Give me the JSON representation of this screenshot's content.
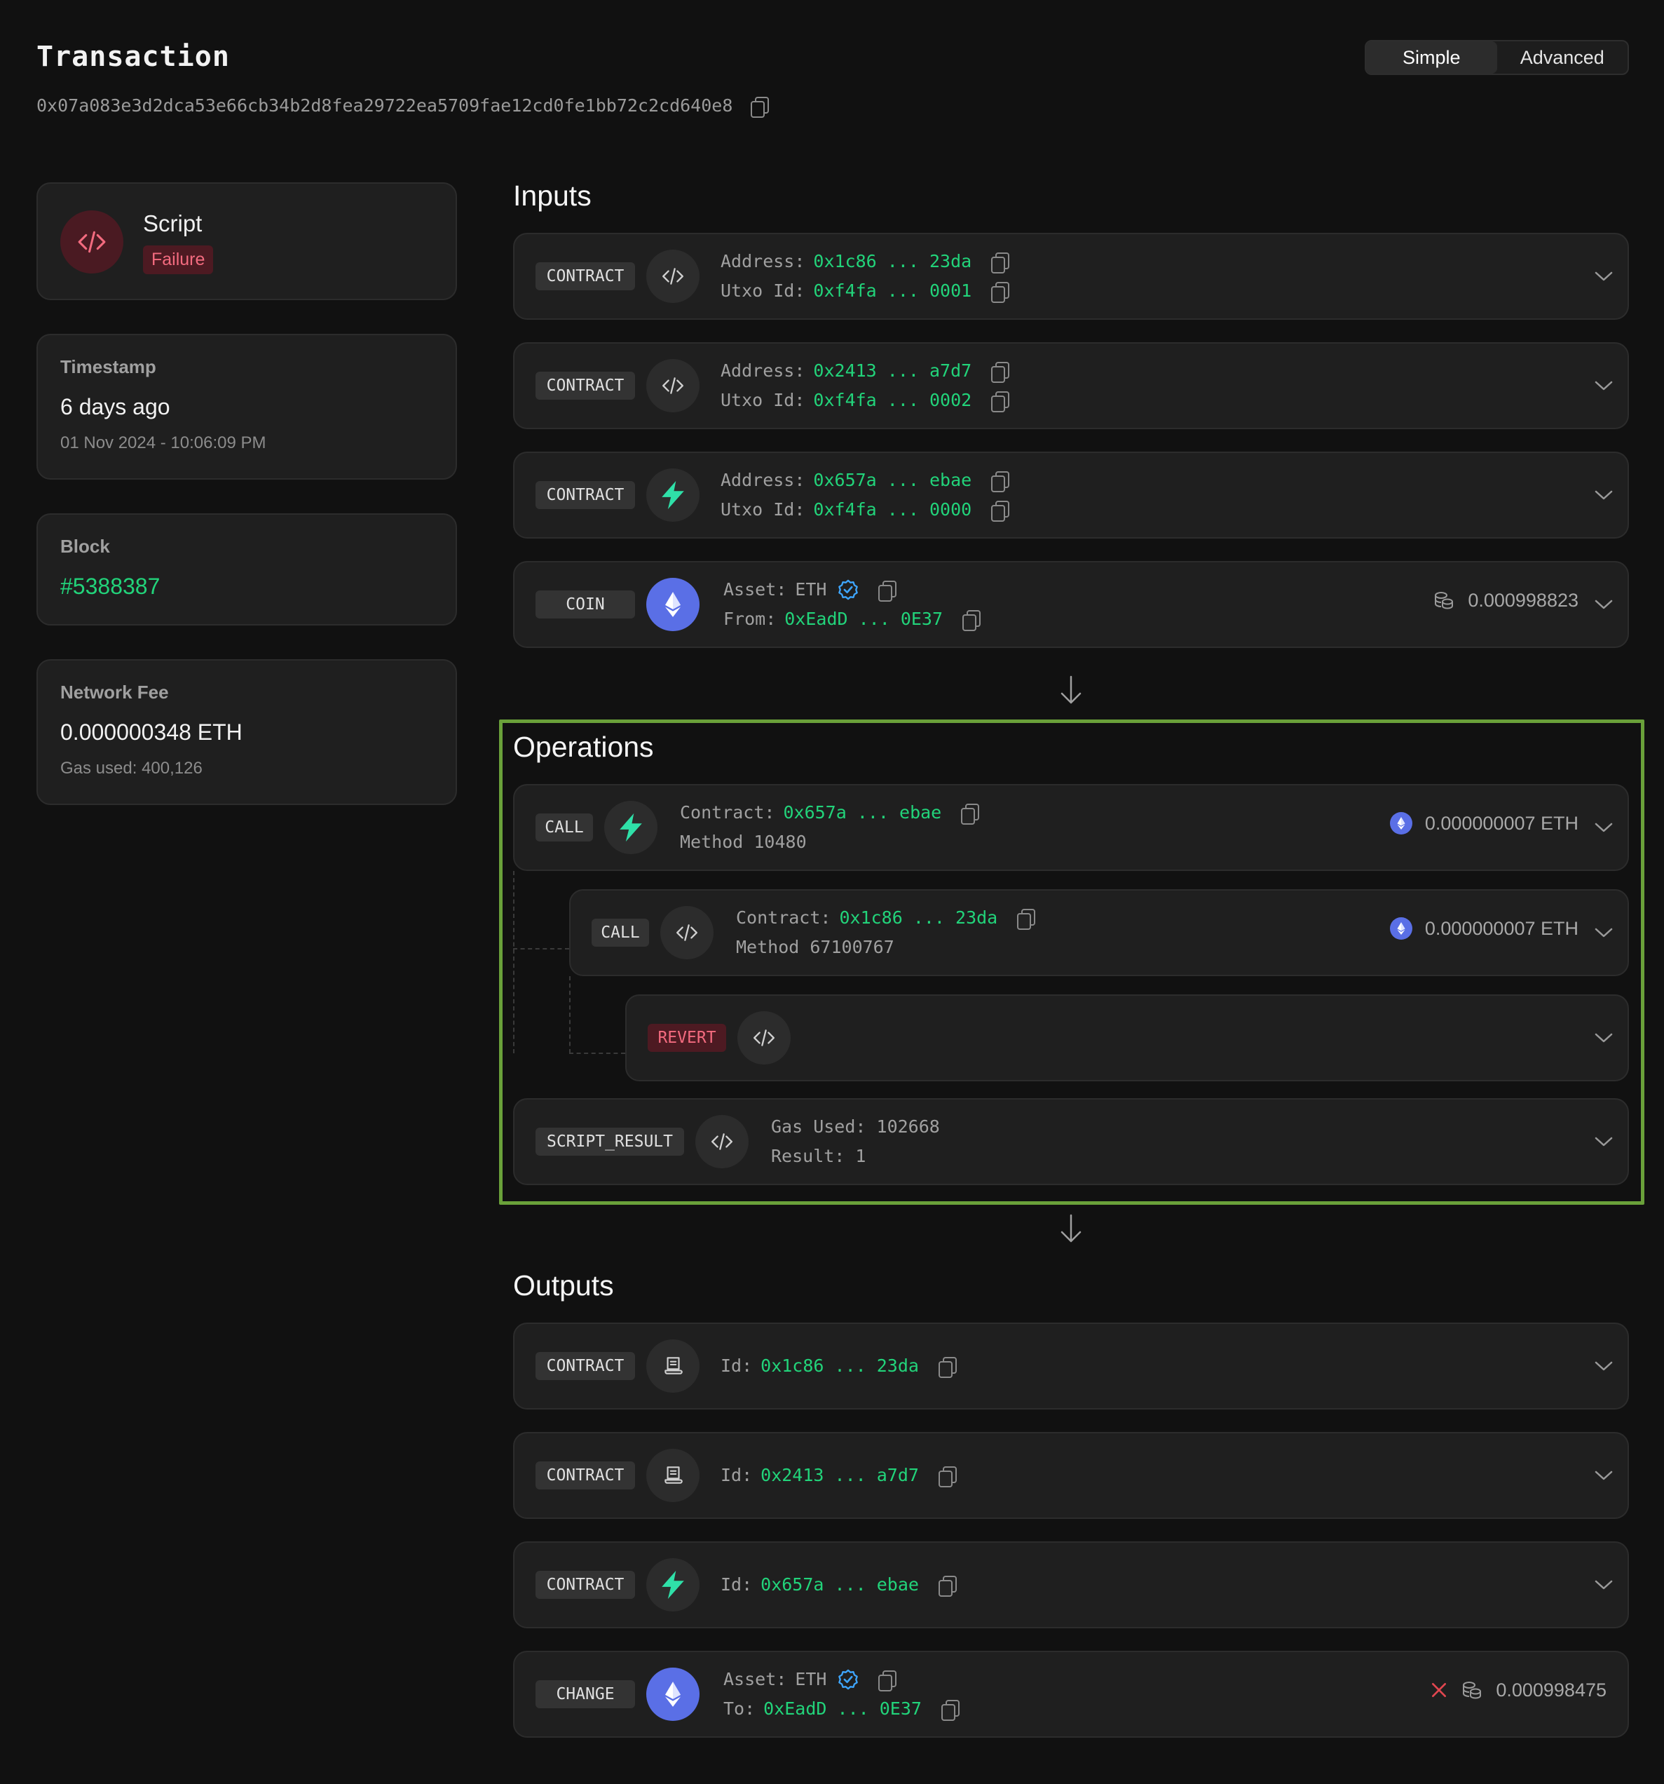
{
  "header": {
    "title": "Transaction",
    "hash": "0x07a083e3d2dca53e66cb34b2d8fea29722ea5709fae12cd0fe1bb72c2cd640e8",
    "view_toggle": {
      "simple": "Simple",
      "advanced": "Advanced",
      "active": "Simple"
    }
  },
  "summary": {
    "type": "Script",
    "status": "Failure",
    "timestamp": {
      "label": "Timestamp",
      "relative": "6 days ago",
      "absolute": "01 Nov 2024 - 10:06:09 PM"
    },
    "block": {
      "label": "Block",
      "value": "#5388387"
    },
    "fee": {
      "label": "Network Fee",
      "value": "0.000000348 ETH",
      "gas": "Gas used: 400,126"
    }
  },
  "inputs": {
    "title": "Inputs",
    "items": [
      {
        "tag": "CONTRACT",
        "icon": "code-icon",
        "k1": "Address:",
        "v1": "0x1c86 ... 23da",
        "k2": "Utxo Id:",
        "v2": "0xf4fa ... 0001"
      },
      {
        "tag": "CONTRACT",
        "icon": "code-icon",
        "k1": "Address:",
        "v1": "0x2413 ... a7d7",
        "k2": "Utxo Id:",
        "v2": "0xf4fa ... 0002"
      },
      {
        "tag": "CONTRACT",
        "icon": "bolt-icon",
        "k1": "Address:",
        "v1": "0x657a ... ebae",
        "k2": "Utxo Id:",
        "v2": "0xf4fa ... 0000"
      },
      {
        "tag": "COIN",
        "icon": "eth-icon",
        "k1": "Asset:",
        "v1": "ETH",
        "k2": "From:",
        "v2": "0xEadD ... 0E37",
        "amount": "0.000998823"
      }
    ]
  },
  "operations": {
    "title": "Operations",
    "items": [
      {
        "tag": "CALL",
        "icon": "bolt-icon",
        "k1": "Contract:",
        "v1": "0x657a ... ebae",
        "line2": "Method 10480",
        "amount": "0.000000007 ETH"
      },
      {
        "tag": "CALL",
        "icon": "code-icon",
        "k1": "Contract:",
        "v1": "0x1c86 ... 23da",
        "line2": "Method 67100767",
        "amount": "0.000000007 ETH"
      },
      {
        "tag": "REVERT",
        "icon": "code-icon"
      },
      {
        "tag": "SCRIPT_RESULT",
        "icon": "code-icon",
        "line1": "Gas Used: 102668",
        "line2": "Result: 1"
      }
    ]
  },
  "outputs": {
    "title": "Outputs",
    "items": [
      {
        "tag": "CONTRACT",
        "icon": "contract-icon",
        "k1": "Id:",
        "v1": "0x1c86 ... 23da"
      },
      {
        "tag": "CONTRACT",
        "icon": "contract-icon",
        "k1": "Id:",
        "v1": "0x2413 ... a7d7"
      },
      {
        "tag": "CONTRACT",
        "icon": "bolt-icon",
        "k1": "Id:",
        "v1": "0x657a ... ebae"
      },
      {
        "tag": "CHANGE",
        "icon": "eth-icon",
        "k1": "Asset:",
        "v1": "ETH",
        "k2": "To:",
        "v2": "0xEadD ... 0E37",
        "amount": "0.000998475"
      }
    ]
  },
  "colors": {
    "accent_green": "#22d37a",
    "failure_red": "#f36b7f",
    "highlight_box": "#6aa13a",
    "eth_blue": "#5a6fe6"
  }
}
